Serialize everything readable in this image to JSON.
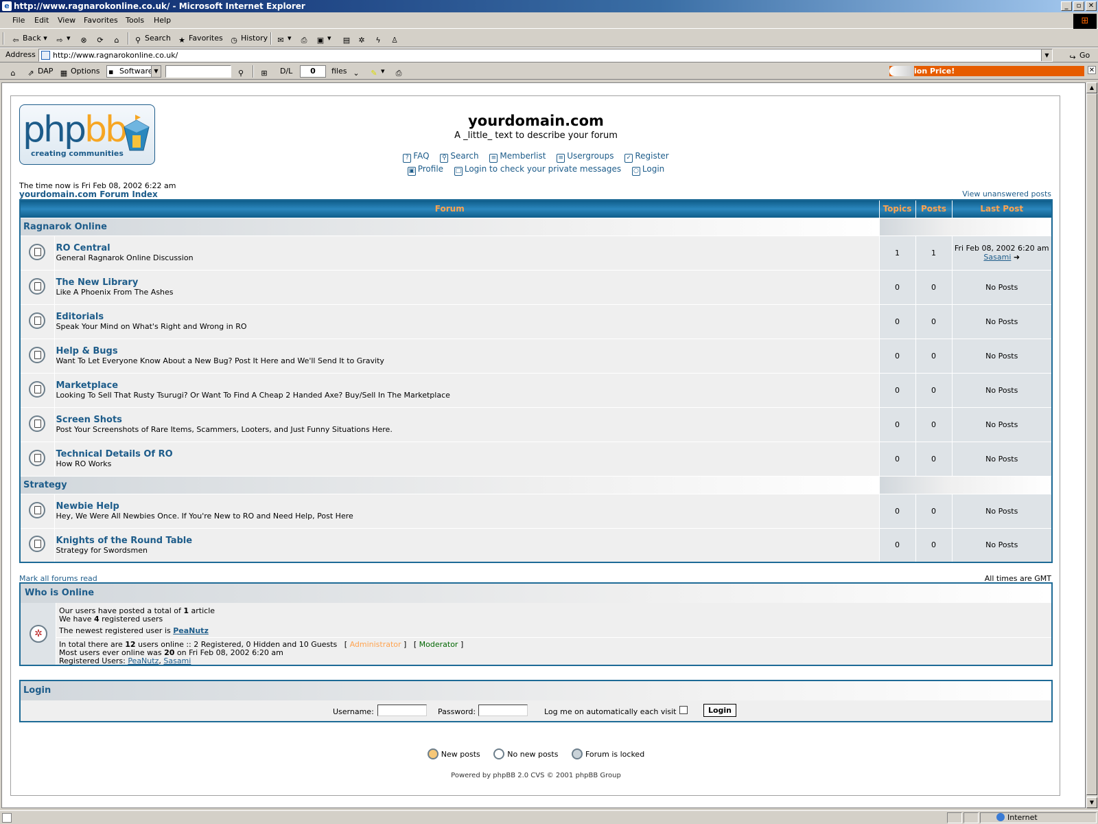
{
  "window": {
    "title": "http://www.ragnarokonline.co.uk/ - Microsoft Internet Explorer",
    "app_icon": "ie-icon",
    "controls": [
      "_",
      "▫",
      "✕"
    ]
  },
  "menubar": [
    "File",
    "Edit",
    "View",
    "Favorites",
    "Tools",
    "Help"
  ],
  "toolbar": {
    "back": "Back",
    "search": "Search",
    "favorites": "Favorites",
    "history": "History"
  },
  "address": {
    "label": "Address",
    "url": "http://www.ragnarokonline.co.uk/",
    "go": "Go"
  },
  "linkbar": {
    "dap": "DAP",
    "options": "Options",
    "software": "Software",
    "dl_label": "D/L",
    "dl_count": "0",
    "files": "files",
    "ad_text": "ion Price!"
  },
  "page": {
    "logo": {
      "php": "php",
      "bb": "bb",
      "tagline": "creating  communities"
    },
    "site_title": "yourdomain.com",
    "site_desc": "A _little_ text to describe your forum",
    "nav1": [
      {
        "label": "FAQ",
        "icon": "faq-icon"
      },
      {
        "label": "Search",
        "icon": "search-icon"
      },
      {
        "label": "Memberlist",
        "icon": "memberlist-icon"
      },
      {
        "label": "Usergroups",
        "icon": "usergroups-icon"
      },
      {
        "label": "Register",
        "icon": "register-icon"
      }
    ],
    "nav2": [
      {
        "label": "Profile",
        "icon": "profile-icon"
      },
      {
        "label": "Login to check your private messages",
        "icon": "messages-icon"
      },
      {
        "label": "Login",
        "icon": "login-icon"
      }
    ],
    "time_now": "The time now is Fri Feb 08, 2002 6:22 am",
    "forum_index": "yourdomain.com Forum Index",
    "unanswered": "View unanswered posts",
    "table_headers": {
      "forum": "Forum",
      "topics": "Topics",
      "posts": "Posts",
      "last_post": "Last Post"
    },
    "categories": [
      {
        "name": "Ragnarok Online",
        "forums": [
          {
            "name": "RO Central",
            "desc": "General Ragnarok Online Discussion",
            "topics": "1",
            "posts": "1",
            "last_post": "Fri Feb 08, 2002 6:20 am",
            "last_user": "Sasami"
          },
          {
            "name": "The New Library",
            "desc": "Like A Phoenix From The Ashes",
            "topics": "0",
            "posts": "0",
            "last_post": "No Posts"
          },
          {
            "name": "Editorials",
            "desc": "Speak Your Mind on What's Right and Wrong in RO",
            "topics": "0",
            "posts": "0",
            "last_post": "No Posts"
          },
          {
            "name": "Help & Bugs",
            "desc": "Want To Let Everyone Know About a New Bug? Post It Here and We'll Send It to Gravity",
            "topics": "0",
            "posts": "0",
            "last_post": "No Posts"
          },
          {
            "name": "Marketplace",
            "desc": "Looking To Sell That Rusty Tsurugi? Or Want To Find A Cheap 2 Handed Axe? Buy/Sell In The Marketplace",
            "topics": "0",
            "posts": "0",
            "last_post": "No Posts"
          },
          {
            "name": "Screen Shots",
            "desc": "Post Your Screenshots of Rare Items, Scammers, Looters, and Just Funny Situations Here.",
            "topics": "0",
            "posts": "0",
            "last_post": "No Posts"
          },
          {
            "name": "Technical Details Of RO",
            "desc": "How RO Works",
            "topics": "0",
            "posts": "0",
            "last_post": "No Posts"
          }
        ]
      },
      {
        "name": "Strategy",
        "forums": [
          {
            "name": "Newbie Help",
            "desc": "Hey, We Were All Newbies Once. If You're New to RO and Need Help, Post Here",
            "topics": "0",
            "posts": "0",
            "last_post": "No Posts"
          },
          {
            "name": "Knights of the Round Table",
            "desc": "Strategy for Swordsmen",
            "topics": "0",
            "posts": "0",
            "last_post": "No Posts"
          }
        ]
      }
    ],
    "mark_read": "Mark all forums read",
    "all_times": "All times are GMT",
    "who_online": {
      "title": "Who is Online",
      "line1_a": "Our users have posted a total of ",
      "line1_b": "1",
      "line1_c": " article",
      "line2_a": "We have ",
      "line2_b": "4",
      "line2_c": " registered users",
      "line3_a": "The newest registered user is ",
      "line3_user": "PeaNutz",
      "line4_a": "In total there are ",
      "line4_b": "12",
      "line4_c": " users online :: 2 Registered, 0 Hidden and 10 Guests",
      "admin": "Administrator",
      "moderator": "Moderator",
      "line5_a": "Most users ever online was ",
      "line5_b": "20",
      "line5_c": " on Fri Feb 08, 2002 6:20 am",
      "line6_a": "Registered Users: ",
      "reg_users": [
        "PeaNutz",
        "Sasami"
      ]
    },
    "login": {
      "title": "Login",
      "username": "Username:",
      "password": "Password:",
      "auto": "Log me on automatically each visit",
      "button": "Login"
    },
    "legend": {
      "new": "New posts",
      "no_new": "No new posts",
      "locked": "Forum is locked"
    },
    "powered": "Powered by phpBB 2.0 CVS © 2001 phpBB Group"
  },
  "statusbar": {
    "zone": "Internet"
  },
  "colors": {
    "link": "#1d5c8a",
    "header_text": "#ffa34f",
    "header_bg": "#0f5d8a",
    "row1": "#efefef",
    "row2": "#dee3e7"
  }
}
